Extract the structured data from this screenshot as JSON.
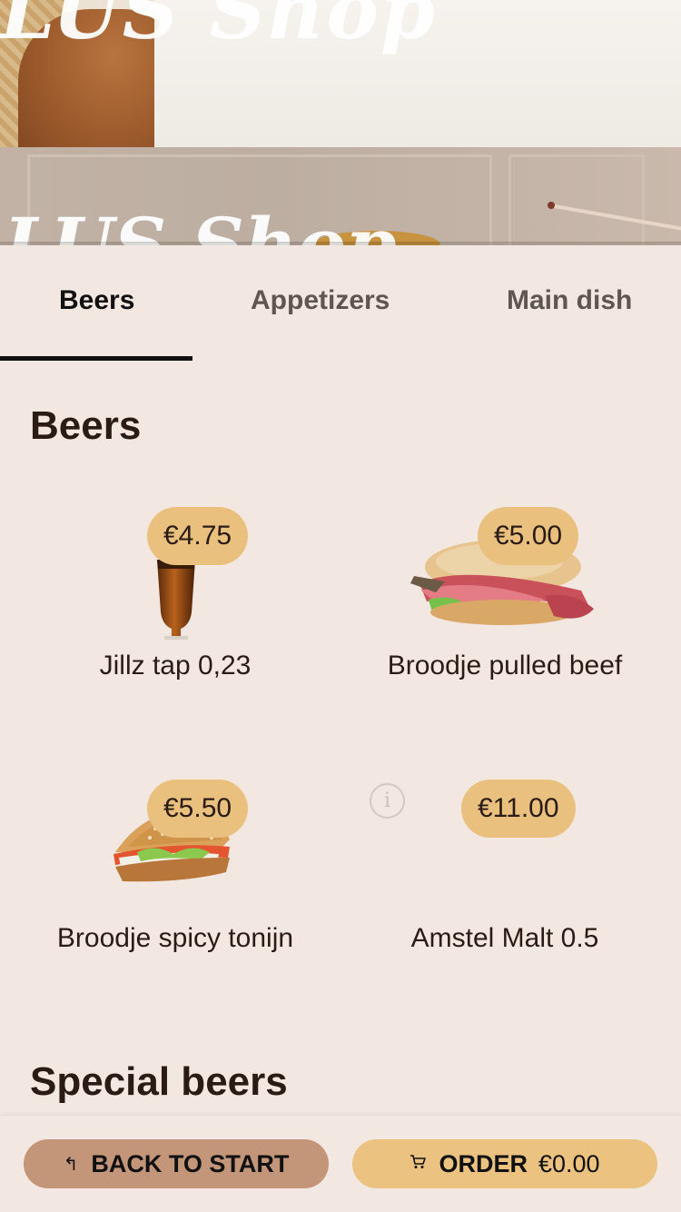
{
  "hero": {
    "logo_top": "LUS Shop",
    "logo_bottom": "LUS Shop"
  },
  "tabs": [
    {
      "label": "Beers",
      "active": true
    },
    {
      "label": "Appetizers",
      "active": false
    },
    {
      "label": "Main dish",
      "active": false
    }
  ],
  "sections": [
    {
      "title": "Beers",
      "products": [
        {
          "name": "Jillz tap 0,23",
          "price": "€4.75",
          "image": "beer-glass"
        },
        {
          "name": "Broodje pulled beef",
          "price": "€5.00",
          "image": "beef-sandwich"
        },
        {
          "name": "Broodje spicy tonijn",
          "price": "€5.50",
          "image": "tuna-sandwich"
        },
        {
          "name": "Amstel Malt 0.5",
          "price": "€11.00",
          "image": "none",
          "info_icon": "info-icon"
        }
      ]
    },
    {
      "title": "Special beers",
      "products": []
    }
  ],
  "bottom_bar": {
    "back_label": "BACK TO START",
    "back_icon": "return-arrow-icon",
    "order_label": "ORDER",
    "order_total": "€0.00",
    "order_icon": "cart-icon"
  },
  "colors": {
    "background": "#f3e8e1",
    "price_badge": "#e9c07e",
    "back_button": "#c39579",
    "order_button": "#ebc27f",
    "text": "#2a1c15"
  }
}
